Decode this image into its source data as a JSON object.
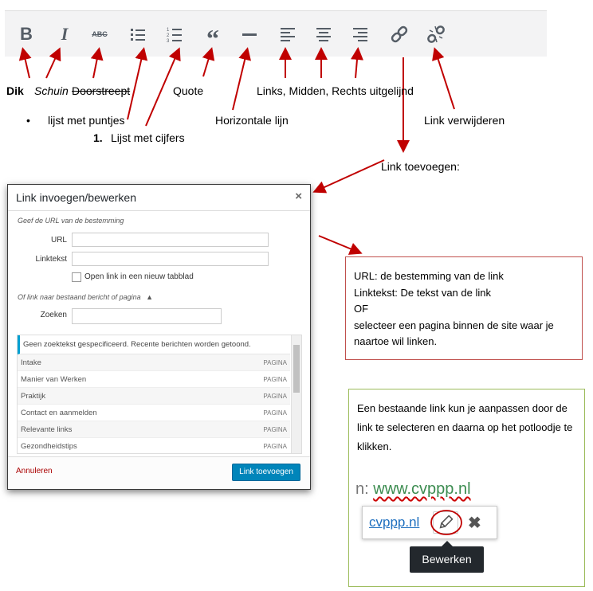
{
  "toolbar": {
    "buttons": [
      {
        "name": "bold",
        "glyph": "B"
      },
      {
        "name": "italic",
        "glyph": "I"
      },
      {
        "name": "strikethrough",
        "glyph": "ABC"
      },
      {
        "name": "bullet-list"
      },
      {
        "name": "numbered-list"
      },
      {
        "name": "quote",
        "glyph": "66"
      },
      {
        "name": "horizontal-line"
      },
      {
        "name": "align-left"
      },
      {
        "name": "align-center"
      },
      {
        "name": "align-right"
      },
      {
        "name": "link"
      },
      {
        "name": "unlink"
      }
    ]
  },
  "captions": {
    "bold": "Dik",
    "italic": "Schuin",
    "strike": "Doorstreept",
    "quote": "Quote",
    "align": "Links,  Midden, Rechts uitgelijnd",
    "bullets": "lijst met puntjes",
    "numbers_prefix": "1.",
    "numbers": "Lijst met cijfers",
    "hr": "Horizontale lijn",
    "unlink": "Link verwijderen",
    "add_link": "Link toevoegen:",
    "bullet_dot": "•"
  },
  "dialog": {
    "title": "Link invoegen/bewerken",
    "close": "×",
    "url_hint": "Geef de URL van de bestemming",
    "url_label": "URL",
    "linktext_label": "Linktekst",
    "new_tab_label": "Open link in een nieuw tabblad",
    "existing_label": "Of link naar bestaand bericht of pagina",
    "existing_toggle": "▲",
    "search_label": "Zoeken",
    "results_notice": "Geen zoektekst gespecificeerd. Recente berichten worden getoond.",
    "results": [
      {
        "title": "Intake",
        "type": "PAGINA"
      },
      {
        "title": "Manier van Werken",
        "type": "PAGINA"
      },
      {
        "title": "Praktijk",
        "type": "PAGINA"
      },
      {
        "title": "Contact en aanmelden",
        "type": "PAGINA"
      },
      {
        "title": "Relevante links",
        "type": "PAGINA"
      },
      {
        "title": "Gezondheidstips",
        "type": "PAGINA"
      }
    ],
    "cancel": "Annuleren",
    "submit": "Link toevoegen"
  },
  "info_box": {
    "lines": [
      "URL: de bestemming van de link",
      "Linktekst: De tekst van de link",
      "OF",
      "selecteer een pagina binnen de site waar je",
      "naartoe wil linken."
    ]
  },
  "edit_box": {
    "text": "Een bestaande link kun je aanpassen door de link te selecteren en daarna op het potloodje te klikken.",
    "url_prefix": "n: ",
    "url_value": "www.cvppp.nl",
    "popup_link": "cvppp.nl",
    "close": "✖",
    "tooltip": "Bewerken"
  },
  "colors": {
    "arrow": "#c00000",
    "primary_button": "#0085ba",
    "info_box_border": "#c0504d",
    "edit_box_border": "#9bbb59",
    "notice_accent": "#00a0d2"
  }
}
